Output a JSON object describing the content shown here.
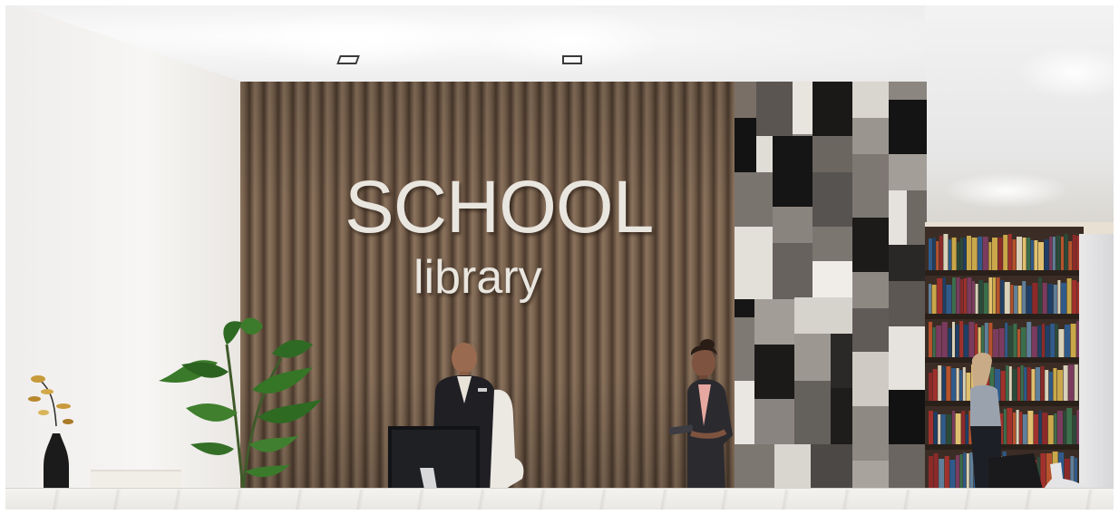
{
  "sign": {
    "title": "SCHOOL",
    "subtitle": "library"
  },
  "colors": {
    "wood": "#6f5b49",
    "sign_text": "#e9e5df",
    "wall": "#f4f2ef",
    "counter": "#f4f3f1"
  },
  "scene_objects": [
    "ceiling-downlight",
    "wood-slat-wall",
    "patchwork-tile-wall",
    "potted-plant",
    "vase-with-branch",
    "receptionist",
    "staff-member-with-tablet",
    "library-visitor",
    "bookshelf",
    "computer-monitor",
    "reception-chair",
    "reception-counter"
  ]
}
